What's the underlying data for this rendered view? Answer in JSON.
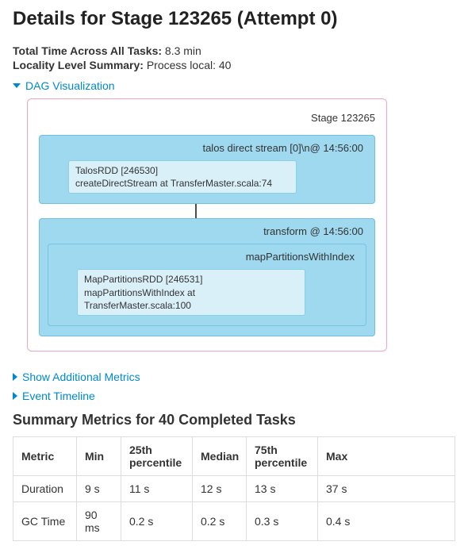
{
  "header": {
    "title": "Details for Stage 123265 (Attempt 0)"
  },
  "meta": {
    "total_time_label": "Total Time Across All Tasks:",
    "total_time_value": "8.3 min",
    "locality_label": "Locality Level Summary:",
    "locality_value": "Process local: 40"
  },
  "collapsers": {
    "dag": "DAG Visualization",
    "show_additional": "Show Additional Metrics",
    "event_timeline": "Event Timeline"
  },
  "dag": {
    "stage_label": "Stage 123265",
    "block1": {
      "label": "talos direct stream [0]\\n@ 14:56:00",
      "leaf_line1": "TalosRDD [246530]",
      "leaf_line2": "createDirectStream at TransferMaster.scala:74"
    },
    "block2": {
      "label": "transform @ 14:56:00",
      "inner_label": "mapPartitionsWithIndex",
      "leaf_line1": "MapPartitionsRDD [246531]",
      "leaf_line2": "mapPartitionsWithIndex at TransferMaster.scala:100"
    }
  },
  "summary": {
    "title": "Summary Metrics for 40 Completed Tasks",
    "columns": {
      "metric": "Metric",
      "min": "Min",
      "p25": "25th percentile",
      "median": "Median",
      "p75": "75th percentile",
      "max": "Max"
    },
    "rows": [
      {
        "metric": "Duration",
        "min": "9 s",
        "p25": "11 s",
        "median": "12 s",
        "p75": "13 s",
        "max": "37 s"
      },
      {
        "metric": "GC Time",
        "min": "90 ms",
        "p25": "0.2 s",
        "median": "0.2 s",
        "p75": "0.3 s",
        "max": "0.4 s"
      }
    ]
  }
}
